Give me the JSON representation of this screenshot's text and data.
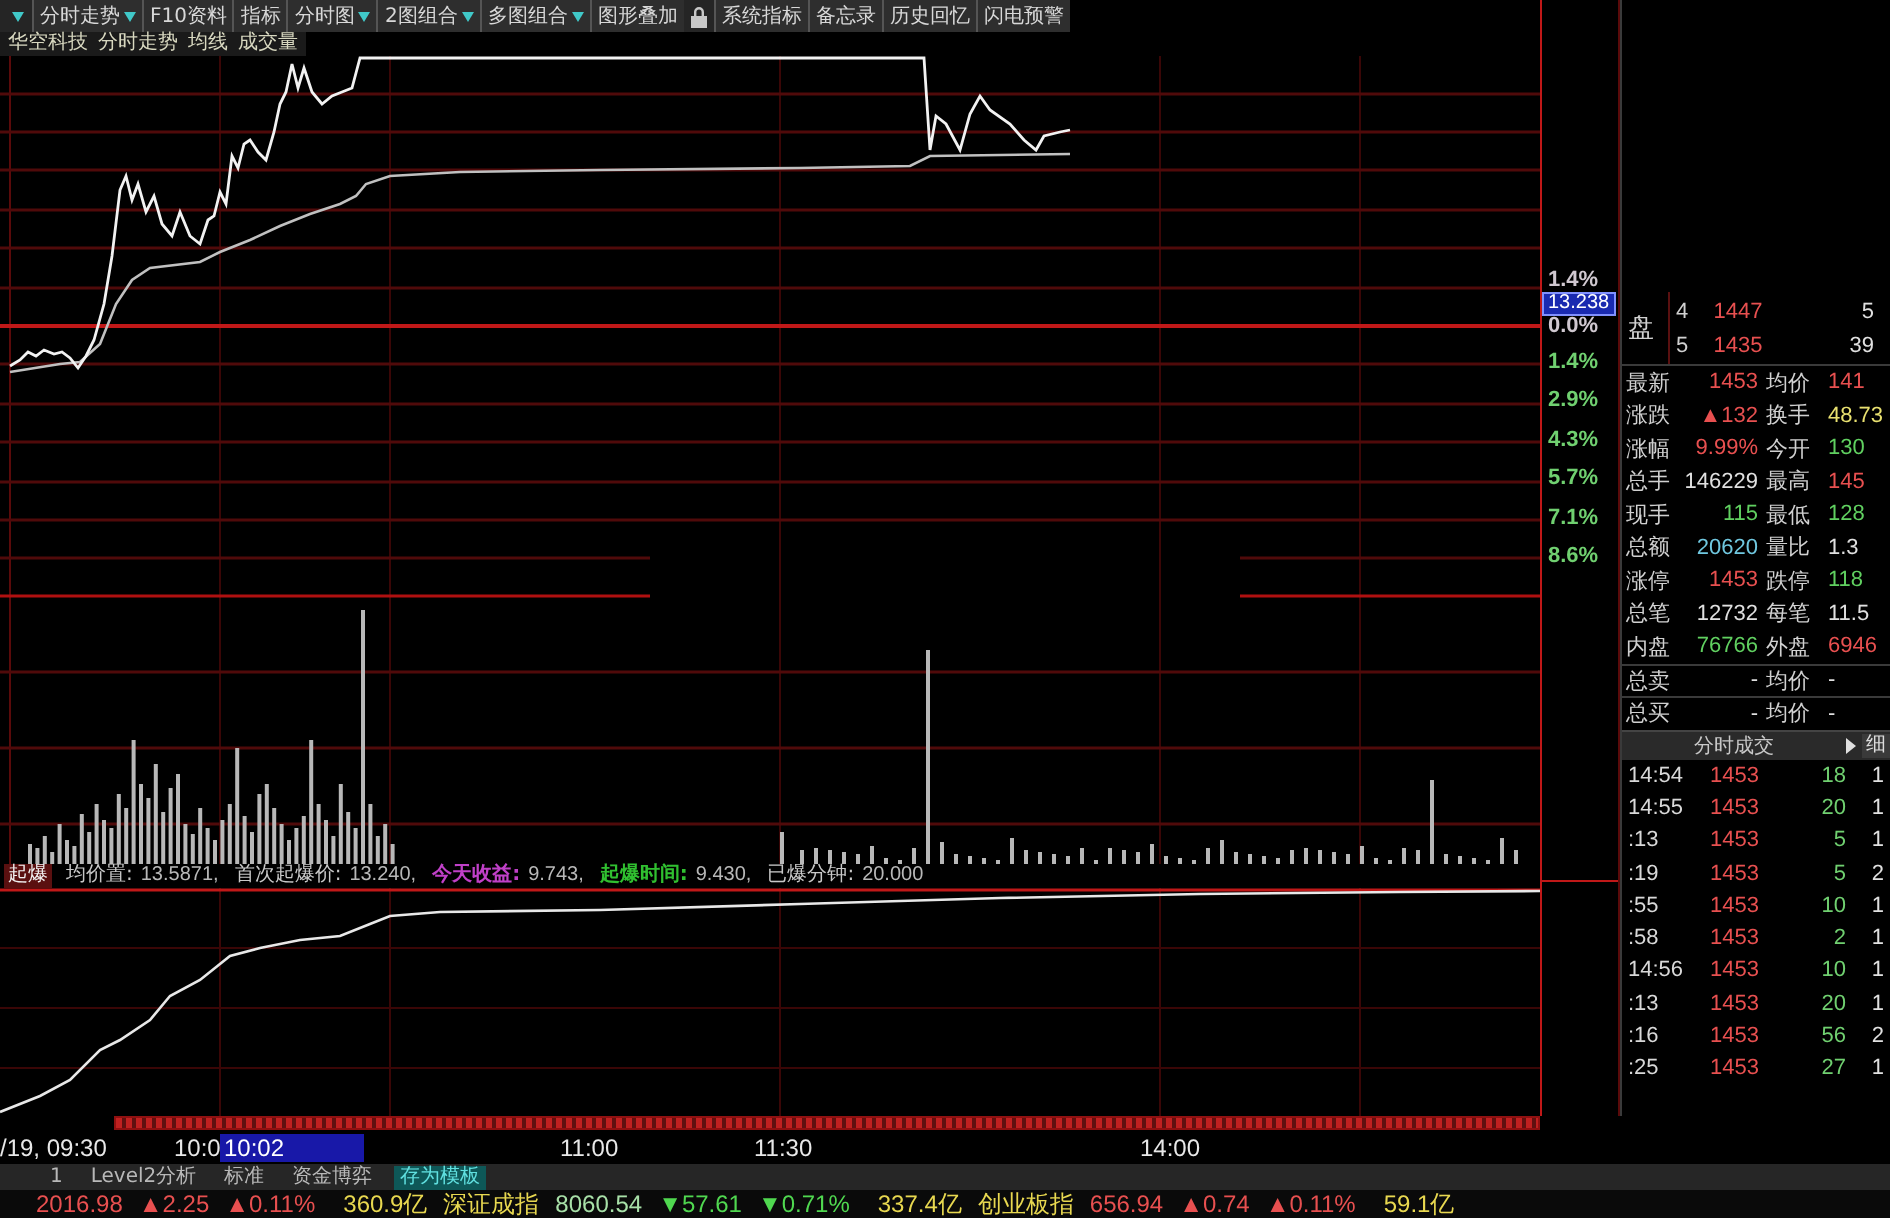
{
  "toolbar": [
    {
      "kind": "button",
      "label": "分时走势",
      "dropdown": true
    },
    {
      "kind": "button",
      "label": "F10资料",
      "dropdown": false
    },
    {
      "kind": "button",
      "label": "指标",
      "dropdown": false
    },
    {
      "kind": "button",
      "label": "分时图",
      "dropdown": true
    },
    {
      "kind": "button",
      "label": "2图组合",
      "dropdown": true
    },
    {
      "kind": "button",
      "label": "多图组合",
      "dropdown": true
    },
    {
      "kind": "button",
      "label": "图形叠加",
      "dropdown": false
    },
    {
      "kind": "lock"
    },
    {
      "kind": "button",
      "label": "系统指标",
      "dropdown": false
    },
    {
      "kind": "button",
      "label": "备忘录",
      "dropdown": false
    },
    {
      "kind": "button",
      "label": "历史回忆",
      "dropdown": false
    },
    {
      "kind": "button",
      "label": "闪电预警",
      "dropdown": false
    }
  ],
  "chart_title": {
    "stock": "华空科技",
    "view": "分时走势",
    "indicators": [
      "均线",
      "成交量"
    ]
  },
  "indicator_bar": {
    "name": "起爆",
    "items": [
      {
        "label": "均价置:",
        "value": "13.5871,"
      },
      {
        "label": "首次起爆价:",
        "value": "13.240,"
      },
      {
        "label": "今天收益:",
        "value": "9.743,",
        "color": "#c040c8"
      },
      {
        "label": "起爆时间:",
        "value": "9.430,",
        "color": "#30c030"
      },
      {
        "label": "已爆分钟:",
        "value": "20.000"
      }
    ]
  },
  "price_scale": [
    {
      "kind": "label",
      "text": "1.4%"
    },
    {
      "kind": "cursor",
      "text": "13.238"
    },
    {
      "kind": "label",
      "text": "0.0%"
    },
    {
      "kind": "label",
      "text": "1.4%",
      "color": "#70d070"
    },
    {
      "kind": "label",
      "text": "2.9%",
      "color": "#70d070"
    },
    {
      "kind": "label",
      "text": "4.3%",
      "color": "#70d070"
    },
    {
      "kind": "label",
      "text": "5.7%",
      "color": "#70d070"
    },
    {
      "kind": "label",
      "text": "7.1%",
      "color": "#70d070"
    },
    {
      "kind": "label",
      "text": "8.6%",
      "color": "#70d070"
    }
  ],
  "order_book": {
    "label": "盘",
    "rows": [
      {
        "seq": "4",
        "price": "1447",
        "volume": "5"
      },
      {
        "seq": "5",
        "price": "1435",
        "volume": "39"
      }
    ]
  },
  "quote": [
    {
      "kind": "quote",
      "left": {
        "label": "最新",
        "value": "1453",
        "color": "#e85050"
      },
      "right": {
        "label": "均价",
        "value": "141",
        "color": "#e85050"
      }
    },
    {
      "kind": "quote",
      "left": {
        "label": "涨跌",
        "value": "▲132",
        "color": "#e85050"
      },
      "right": {
        "label": "换手",
        "value": "48.73",
        "color": "#e8e070"
      }
    },
    {
      "kind": "quote",
      "left": {
        "label": "涨幅",
        "value": "9.99%",
        "color": "#e85050"
      },
      "right": {
        "label": "今开",
        "value": "130",
        "color": "#60d060"
      }
    },
    {
      "kind": "quote",
      "left": {
        "label": "总手",
        "value": "146229",
        "color": "#e0e0e0"
      },
      "right": {
        "label": "最高",
        "value": "145",
        "color": "#e85050"
      }
    },
    {
      "kind": "quote",
      "left": {
        "label": "现手",
        "value": "115",
        "color": "#60d060"
      },
      "right": {
        "label": "最低",
        "value": "128",
        "color": "#60d060"
      }
    },
    {
      "kind": "quote",
      "left": {
        "label": "总额",
        "value": "20620",
        "color": "#70c8e0"
      },
      "right": {
        "label": "量比",
        "value": "1.3",
        "color": "#e0e0e0"
      }
    },
    {
      "kind": "quote",
      "left": {
        "label": "涨停",
        "value": "1453",
        "color": "#e85050"
      },
      "right": {
        "label": "跌停",
        "value": "118",
        "color": "#60d060"
      }
    },
    {
      "kind": "quote",
      "left": {
        "label": "总笔",
        "value": "12732",
        "color": "#e0e0e0"
      },
      "right": {
        "label": "每笔",
        "value": "11.5",
        "color": "#e0e0e0"
      }
    },
    {
      "kind": "quote",
      "left": {
        "label": "内盘",
        "value": "76766",
        "color": "#60d060"
      },
      "right": {
        "label": "外盘",
        "value": "6946",
        "color": "#e85050"
      }
    },
    {
      "kind": "total",
      "left": {
        "label": "总卖",
        "value": "-",
        "color": "#e0e0e0"
      },
      "right": {
        "label": "均价",
        "value": "-",
        "color": "#e0e0e0"
      }
    },
    {
      "kind": "total",
      "left": {
        "label": "总买",
        "value": "-",
        "color": "#e0e0e0"
      },
      "right": {
        "label": "均价",
        "value": "-",
        "color": "#e0e0e0"
      }
    }
  ],
  "trades": {
    "title": "分时成交",
    "button": "细",
    "rows": [
      {
        "time": "14:54",
        "price": "1453",
        "volume": "18",
        "count": "1"
      },
      {
        "time": "14:55",
        "price": "1453",
        "volume": "20",
        "count": "1"
      },
      {
        "time": ":13",
        "price": "1453",
        "volume": "5",
        "count": "1"
      },
      {
        "time": ":19",
        "price": "1453",
        "volume": "5",
        "count": "2"
      },
      {
        "time": ":55",
        "price": "1453",
        "volume": "10",
        "count": "1"
      },
      {
        "time": ":58",
        "price": "1453",
        "volume": "2",
        "count": "1"
      },
      {
        "time": "14:56",
        "price": "1453",
        "volume": "10",
        "count": "1"
      },
      {
        "time": ":13",
        "price": "1453",
        "volume": "20",
        "count": "1"
      },
      {
        "time": ":16",
        "price": "1453",
        "volume": "56",
        "count": "2"
      },
      {
        "time": ":25",
        "price": "1453",
        "volume": "27",
        "count": "1"
      }
    ]
  },
  "time_axis": {
    "labels": [
      "/19, 09:30",
      "10:0",
      "11:00",
      "11:30",
      "14:00"
    ],
    "cursor": "10:02"
  },
  "tabs": [
    {
      "label": "1",
      "selected": false
    },
    {
      "label": "Level2分析",
      "selected": false
    },
    {
      "label": "标准",
      "selected": false
    },
    {
      "label": "资金博弈",
      "selected": false
    },
    {
      "label": "存为模板",
      "selected": true
    }
  ],
  "status_bar": [
    {
      "kind": "point",
      "text": "2016.98",
      "color": "#e85050"
    },
    {
      "kind": "change",
      "text": "▲2.25",
      "color": "#e85050"
    },
    {
      "kind": "percent",
      "text": "▲0.11%",
      "color": "#e85050"
    },
    {
      "kind": "turnover",
      "text": "360.9亿",
      "color": "#e8d850"
    },
    {
      "kind": "index",
      "text": "深证成指",
      "color": "#e8d850"
    },
    {
      "kind": "point",
      "text": "8060.54",
      "color": "#a8e0a8"
    },
    {
      "kind": "change",
      "text": "▼57.61",
      "color": "#50d850"
    },
    {
      "kind": "percent",
      "text": "▼0.71%",
      "color": "#50d850"
    },
    {
      "kind": "turnover",
      "text": "337.4亿",
      "color": "#e8d850"
    },
    {
      "kind": "index",
      "text": "创业板指",
      "color": "#e8d850"
    },
    {
      "kind": "point",
      "text": "656.94",
      "color": "#e85050"
    },
    {
      "kind": "change",
      "text": "▲0.74",
      "color": "#e85050"
    },
    {
      "kind": "percent",
      "text": "▲0.11%",
      "color": "#e85050"
    },
    {
      "kind": "turnover",
      "text": "59.1亿",
      "color": "#e8d850"
    }
  ]
}
